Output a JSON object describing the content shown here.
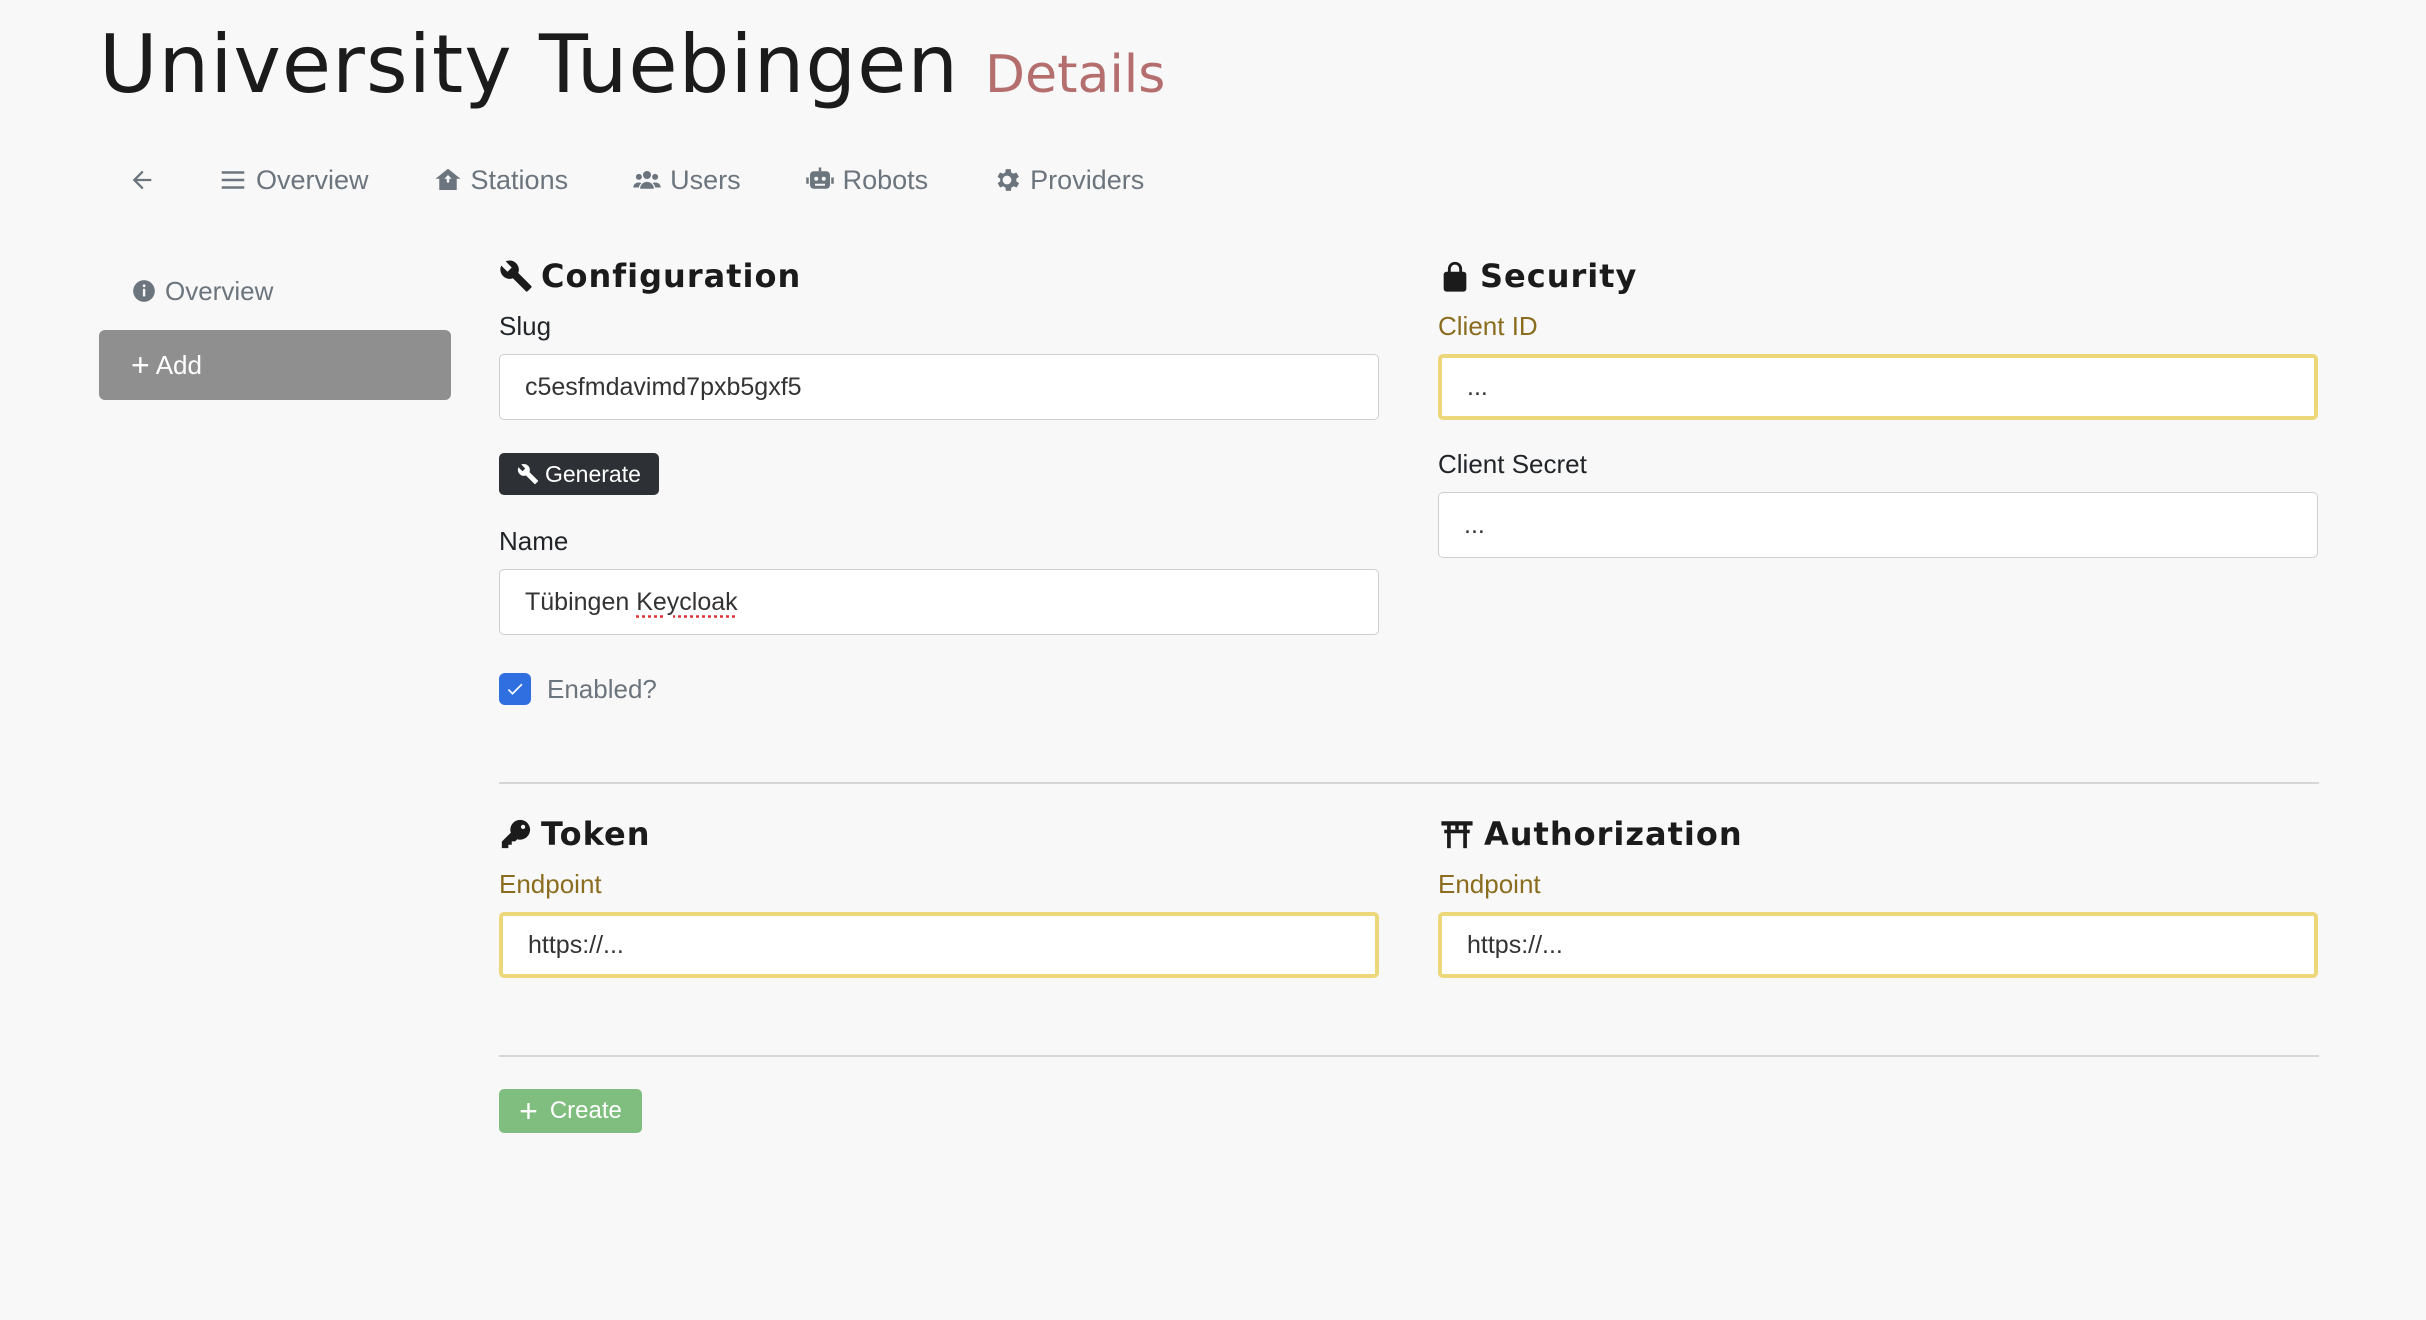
{
  "header": {
    "title": "University Tuebingen",
    "subtitle": "Details"
  },
  "topnav": {
    "items": [
      {
        "label": "Overview",
        "icon": "bars-icon"
      },
      {
        "label": "Stations",
        "icon": "house-icon"
      },
      {
        "label": "Users",
        "icon": "users-icon"
      },
      {
        "label": "Robots",
        "icon": "robot-icon"
      },
      {
        "label": "Providers",
        "icon": "gear-icon"
      }
    ]
  },
  "sidebar": {
    "overview_label": "Overview",
    "add_label": "Add"
  },
  "configuration": {
    "title": "Configuration",
    "slug_label": "Slug",
    "slug_value": "c5esfmdavimd7pxb5gxf5",
    "generate_label": "Generate",
    "name_label": "Name",
    "name_value_prefix": "Tübingen ",
    "name_value_word": "Keycloak",
    "enabled_label": "Enabled?",
    "enabled": true
  },
  "security": {
    "title": "Security",
    "client_id_label": "Client ID",
    "client_id_placeholder": "...",
    "client_secret_label": "Client Secret",
    "client_secret_placeholder": "..."
  },
  "token": {
    "title": "Token",
    "endpoint_label": "Endpoint",
    "endpoint_placeholder": "https://..."
  },
  "authorization": {
    "title": "Authorization",
    "endpoint_label": "Endpoint",
    "endpoint_placeholder": "https://..."
  },
  "actions": {
    "create_label": "Create"
  },
  "colors": {
    "warning_border": "#ecd77a",
    "warning_label": "#8a6d1e",
    "primary": "#2f6fe0",
    "success": "#7fbe7f",
    "subtitle": "#b46e6e"
  }
}
